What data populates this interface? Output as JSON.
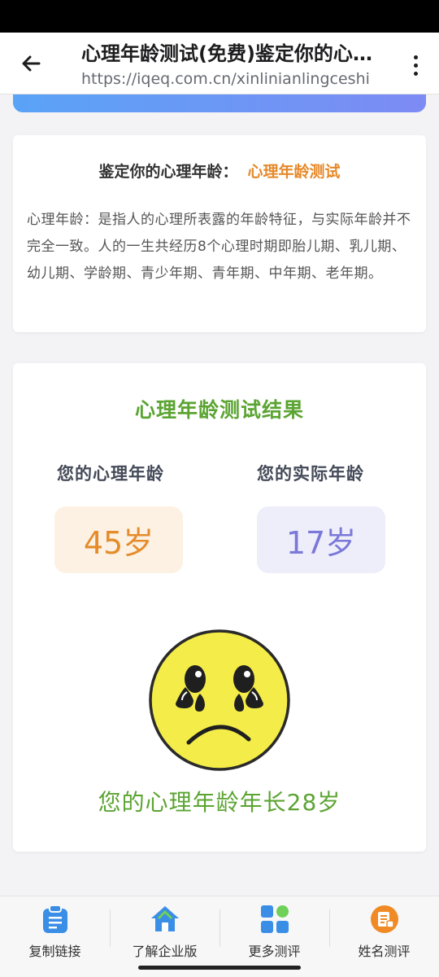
{
  "browser": {
    "title": "心理年龄测试(免费)鉴定你的心理年龄",
    "url": "https://iqeq.com.cn/xinlinianlingceshi"
  },
  "intro": {
    "heading_label": "鉴定你的心理年龄：",
    "heading_highlight": "心理年龄测试",
    "body": "心理年龄：是指人的心理所表露的年龄特征，与实际年龄并不完全一致。人的一生共经历8个心理时期即胎儿期、乳儿期、幼儿期、学龄期、青少年期、青年期、中年期、老年期。"
  },
  "result": {
    "title": "心理年龄测试结果",
    "mental_label": "您的心理年龄",
    "actual_label": "您的实际年龄",
    "mental_age": "45岁",
    "actual_age": "17岁",
    "face_icon": "crying-sad-face-icon",
    "verdict": "您的心理年龄年长28岁"
  },
  "bottom_nav": {
    "items": [
      {
        "label": "复制链接",
        "icon": "clipboard-icon"
      },
      {
        "label": "了解企业版",
        "icon": "home-icon"
      },
      {
        "label": "更多测评",
        "icon": "grid-icon"
      },
      {
        "label": "姓名测评",
        "icon": "name-badge-icon"
      }
    ]
  },
  "colors": {
    "accent_green": "#5ba432",
    "accent_orange": "#e6892a",
    "accent_purple": "#7b78d8",
    "nav_blue": "#3a8ee6"
  }
}
